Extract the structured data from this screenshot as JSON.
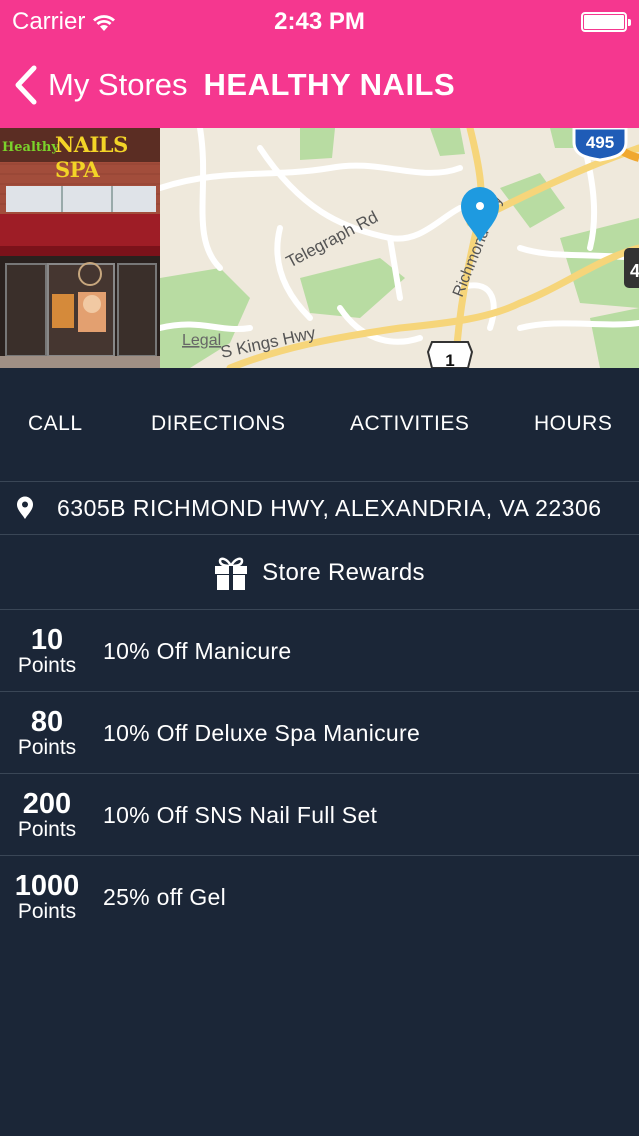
{
  "status_bar": {
    "carrier": "Carrier",
    "time": "2:43 PM"
  },
  "nav": {
    "back_label": "My Stores",
    "title": "HEALTHY NAILS"
  },
  "store_photo": {
    "sign_prefix": "Healthy",
    "sign_main": "NAILS SPA"
  },
  "map": {
    "roads": [
      "Telegraph Rd",
      "Richmond Hwy",
      "S Kings Hwy"
    ],
    "interstate_badge": "495",
    "route_badge": "1",
    "legal_label": "Legal",
    "edge_badge": "4",
    "pin_color": "#1e9ae0"
  },
  "tabs": [
    "CALL",
    "DIRECTIONS",
    "ACTIVITIES",
    "HOURS"
  ],
  "address": "6305B RICHMOND HWY, ALEXANDRIA, VA 22306",
  "rewards": {
    "title": "Store Rewards",
    "items": [
      {
        "points": "10",
        "unit": "Points",
        "label": "10% Off Manicure"
      },
      {
        "points": "80",
        "unit": "Points",
        "label": "10% Off Deluxe Spa Manicure"
      },
      {
        "points": "200",
        "unit": "Points",
        "label": "10% Off SNS Nail Full Set"
      },
      {
        "points": "1000",
        "unit": "Points",
        "label": "25% off Gel"
      }
    ]
  },
  "colors": {
    "brand_pink": "#f5378f",
    "background": "#1b2637",
    "divider": "#3a4656"
  }
}
